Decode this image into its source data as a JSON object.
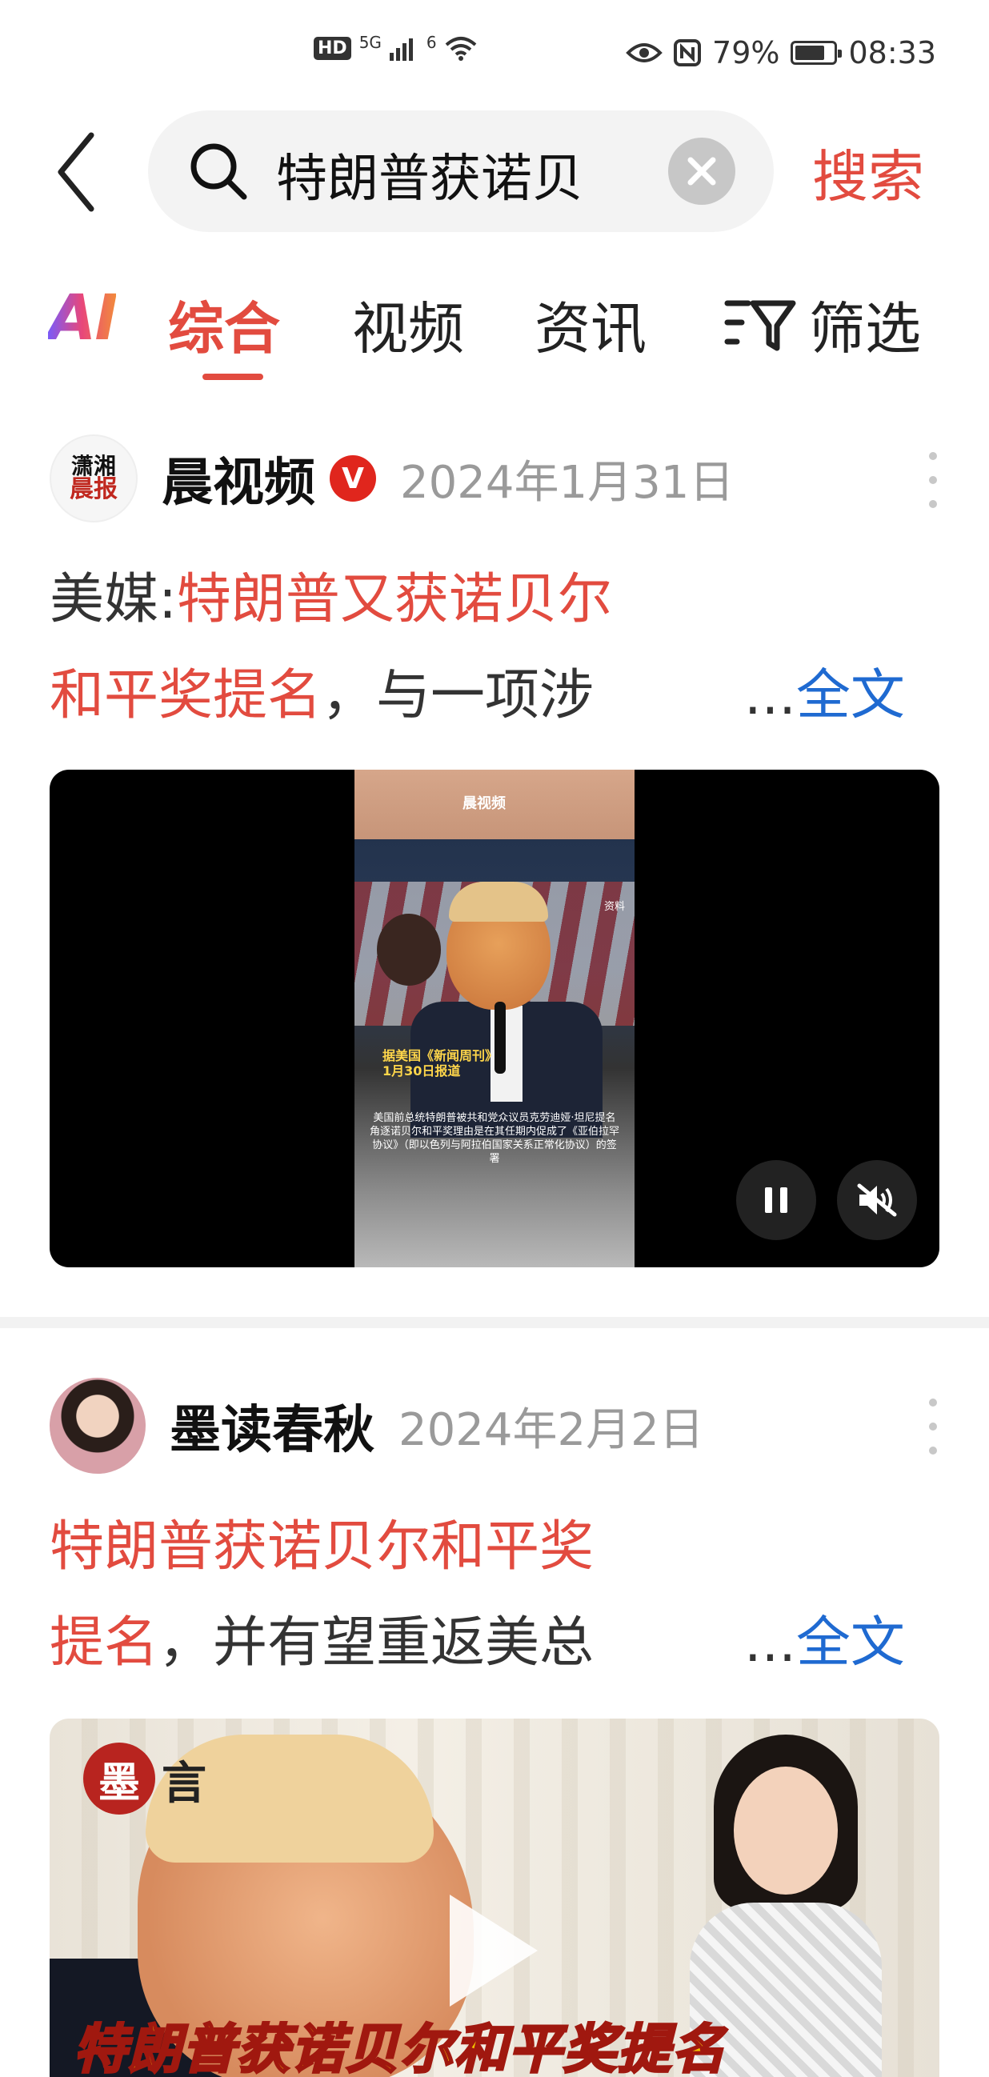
{
  "status_bar": {
    "hd": "HD",
    "network": "5G",
    "wifi_badge": "6",
    "battery_percent": "79%",
    "battery_level": 0.79,
    "time": "08:33"
  },
  "search": {
    "query": "特朗普获诺贝",
    "submit_label": "搜索"
  },
  "tabs": {
    "ai": "AI",
    "items": [
      "综合",
      "视频",
      "资讯"
    ],
    "active_index": 0,
    "filter_label": "筛选"
  },
  "posts": [
    {
      "author": "晨视频",
      "avatar_text": [
        "潇湘",
        "晨报"
      ],
      "verified": "V",
      "date": "2024年1月31日",
      "title_line1_prefix": "美媒:",
      "title_line1_highlight": "特朗普又获诺贝尔",
      "title_line2_highlight": "和平奖提名",
      "title_line2_rest": "，与一项涉",
      "ellipsis": "...",
      "full_text_label": "全文",
      "video": {
        "logo": "晨视频",
        "tag": "资料",
        "source_line1": "据美国《新闻周刊》",
        "source_line2": "1月30日报道",
        "caption": "美国前总统特朗普被共和党众议员克劳迪娅·坦尼提名角逐诺贝尔和平奖理由是在其任期内促成了《亚伯拉罕协议》（即以色列与阿拉伯国家关系正常化协议）的签署"
      }
    },
    {
      "author": "墨读春秋",
      "date": "2024年2月2日",
      "title_line1_highlight": "特朗普获诺贝尔和平奖",
      "title_line2_highlight": "提名",
      "title_line2_rest": "，并有望重返美总",
      "ellipsis": "...",
      "full_text_label": "全文",
      "thumbnail": {
        "logo_char": "墨",
        "logo_char2": "言",
        "caption": "特朗普获诺贝尔和平奖提名"
      }
    }
  ],
  "colors": {
    "accent": "#e24b3f",
    "link": "#1f6ad1",
    "date_gray": "#9a9a9a"
  }
}
